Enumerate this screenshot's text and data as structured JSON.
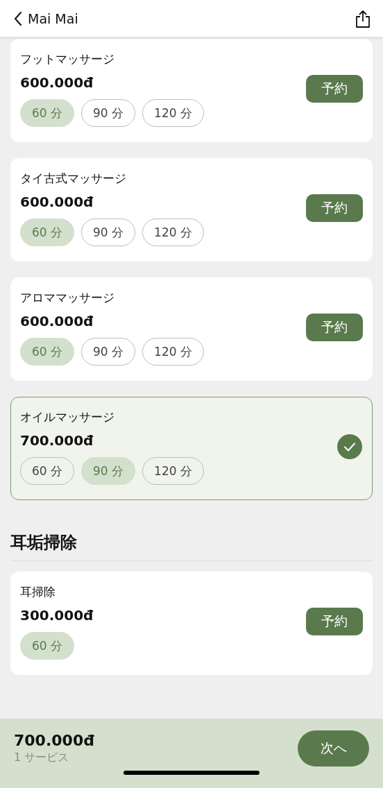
{
  "header": {
    "title": "Mai Mai"
  },
  "sections": [
    {
      "services": [
        {
          "name": "フットマッサージ",
          "price": "600.000đ",
          "selected": false,
          "book_label": "予約",
          "durations": [
            {
              "label": "60 分",
              "selected": true
            },
            {
              "label": "90 分",
              "selected": false
            },
            {
              "label": "120 分",
              "selected": false
            }
          ]
        },
        {
          "name": "タイ古式マッサージ",
          "price": "600.000đ",
          "selected": false,
          "book_label": "予約",
          "durations": [
            {
              "label": "60 分",
              "selected": true
            },
            {
              "label": "90 分",
              "selected": false
            },
            {
              "label": "120 分",
              "selected": false
            }
          ]
        },
        {
          "name": "アロママッサージ",
          "price": "600.000đ",
          "selected": false,
          "book_label": "予約",
          "durations": [
            {
              "label": "60 分",
              "selected": true
            },
            {
              "label": "90 分",
              "selected": false
            },
            {
              "label": "120 分",
              "selected": false
            }
          ]
        },
        {
          "name": "オイルマッサージ",
          "price": "700.000đ",
          "selected": true,
          "durations": [
            {
              "label": "60 分",
              "selected": false
            },
            {
              "label": "90 分",
              "selected": true
            },
            {
              "label": "120 分",
              "selected": false
            }
          ]
        }
      ]
    },
    {
      "title": "耳垢掃除",
      "services": [
        {
          "name": "耳掃除",
          "price": "300.000đ",
          "selected": false,
          "book_label": "予約",
          "durations": [
            {
              "label": "60 分",
              "selected": true
            }
          ]
        }
      ]
    }
  ],
  "footer": {
    "total": "700.000đ",
    "count": "1 サービス",
    "next_label": "次へ"
  }
}
